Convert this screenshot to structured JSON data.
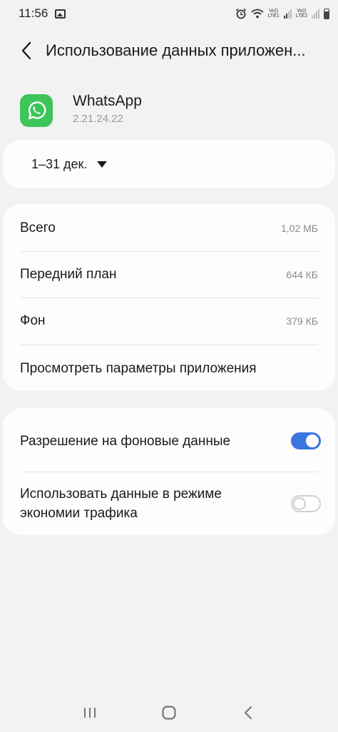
{
  "status_bar": {
    "time": "11:56",
    "volte1": [
      "Vo))",
      "LTE1"
    ],
    "volte2": [
      "Vo))",
      "LTE2"
    ]
  },
  "header": {
    "title": "Использование данных приложен..."
  },
  "app": {
    "name": "WhatsApp",
    "version": "2.21.24.22",
    "brand_color": "#3dc55a"
  },
  "period": {
    "label": "1–31 дек."
  },
  "usage": {
    "rows": [
      {
        "label": "Всего",
        "value": "1,02 МБ"
      },
      {
        "label": "Передний план",
        "value": "644 КБ"
      },
      {
        "label": "Фон",
        "value": "379 КБ"
      }
    ],
    "view_settings_label": "Просмотреть параметры приложения"
  },
  "permissions": {
    "background_data": {
      "label": "Разрешение на фоновые данные",
      "enabled": true
    },
    "data_saver": {
      "label": "Использовать данные в режиме экономии трафика",
      "enabled": false
    }
  },
  "colors": {
    "accent": "#3b75e0",
    "background": "#f2f2f2",
    "card": "#fdfdfd"
  },
  "icons": {
    "back": "back-arrow-icon",
    "dropdown": "triangle-down-icon",
    "nav_recents": "recents-icon",
    "nav_home": "home-icon",
    "nav_back": "nav-back-icon"
  }
}
